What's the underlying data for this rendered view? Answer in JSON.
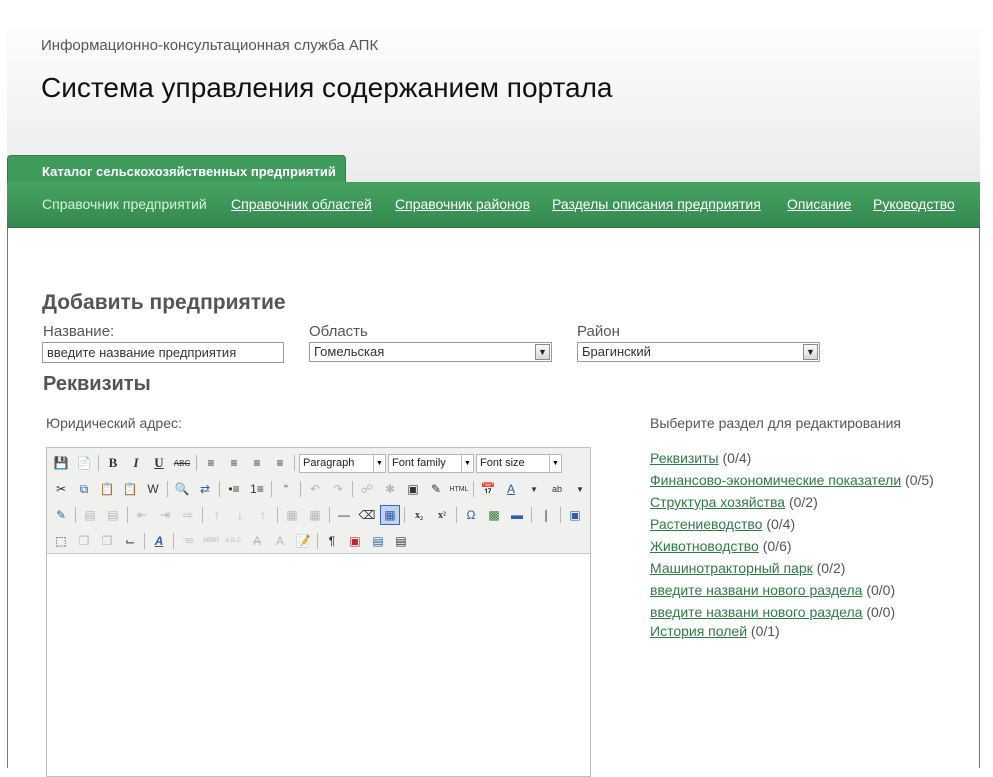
{
  "header": {
    "subtitle": "Информационно-консультационная служба АПК",
    "title": "Система управления содержанием портала"
  },
  "tabs": {
    "active_label": "Каталог сельскохозяйственных предприятий"
  },
  "nav": {
    "items": [
      {
        "label": "Справочник предприятий"
      },
      {
        "label": "Справочник областей"
      },
      {
        "label": "Справочник районов"
      },
      {
        "label": "Разделы описания предприятия"
      },
      {
        "label": "Описание"
      },
      {
        "label": "Руководство"
      }
    ]
  },
  "form": {
    "heading": "Добавить предприятие",
    "name_label": "Название:",
    "name_value": "введите название предприятия",
    "region_label": "Область",
    "region_value": "Гомельская",
    "district_label": "Район",
    "district_value": "Брагинский"
  },
  "details": {
    "heading": "Реквизиты",
    "address_label": "Юридический адрес:"
  },
  "editor": {
    "format_select": "Paragraph",
    "font_family_select": "Font family",
    "font_size_select": "Font size"
  },
  "sections": {
    "title": "Выберите раздел для редактирования",
    "items": [
      {
        "label": "Реквизиты",
        "count": "(0/4)"
      },
      {
        "label": "Финансово-экономические показатели",
        "count": "(0/5)"
      },
      {
        "label": "Структура хозяйства",
        "count": "(0/2)"
      },
      {
        "label": "Растениеводство",
        "count": "(0/4)"
      },
      {
        "label": "Животноводство",
        "count": "(0/6)"
      },
      {
        "label": "Машинотракторный парк",
        "count": "(0/2)"
      },
      {
        "label": "введите названи нового раздела",
        "count": "(0/0)"
      },
      {
        "label": "введите названи нового раздела",
        "count": "(0/0)"
      },
      {
        "label": "История полей",
        "count": "(0/1)"
      }
    ]
  }
}
